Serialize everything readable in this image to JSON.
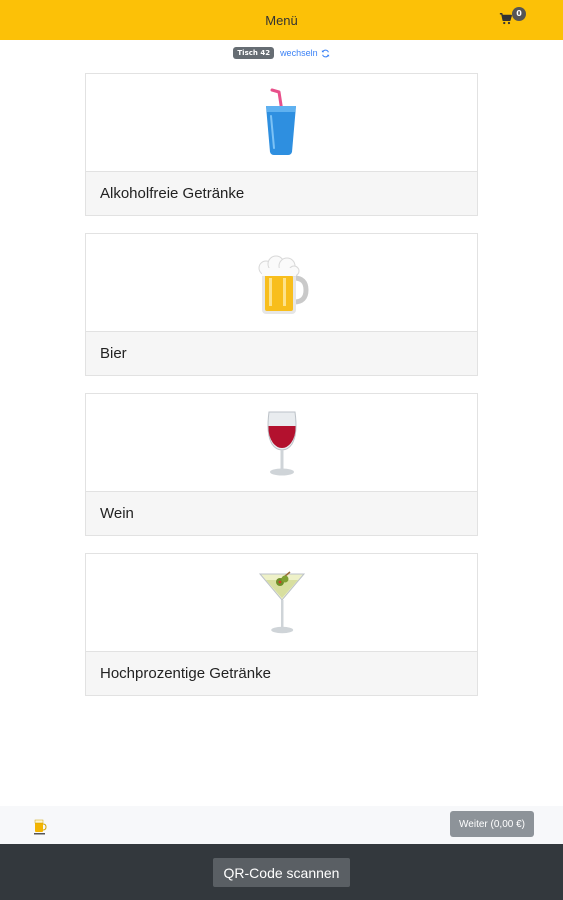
{
  "header": {
    "title": "Menü",
    "cart_count": "0",
    "accent_color": "#fcc107"
  },
  "table": {
    "badge": "Tisch 42",
    "change_label": "wechseln"
  },
  "categories": [
    {
      "label": "Alkoholfreie Getränke",
      "icon": "soft-drink-icon"
    },
    {
      "label": "Bier",
      "icon": "beer-mug-icon"
    },
    {
      "label": "Wein",
      "icon": "wine-glass-icon"
    },
    {
      "label": "Hochprozentige Getränke",
      "icon": "cocktail-glass-icon"
    }
  ],
  "footer": {
    "next_label": "Weiter (0,00 €)",
    "scan_label": "QR-Code scannen"
  }
}
